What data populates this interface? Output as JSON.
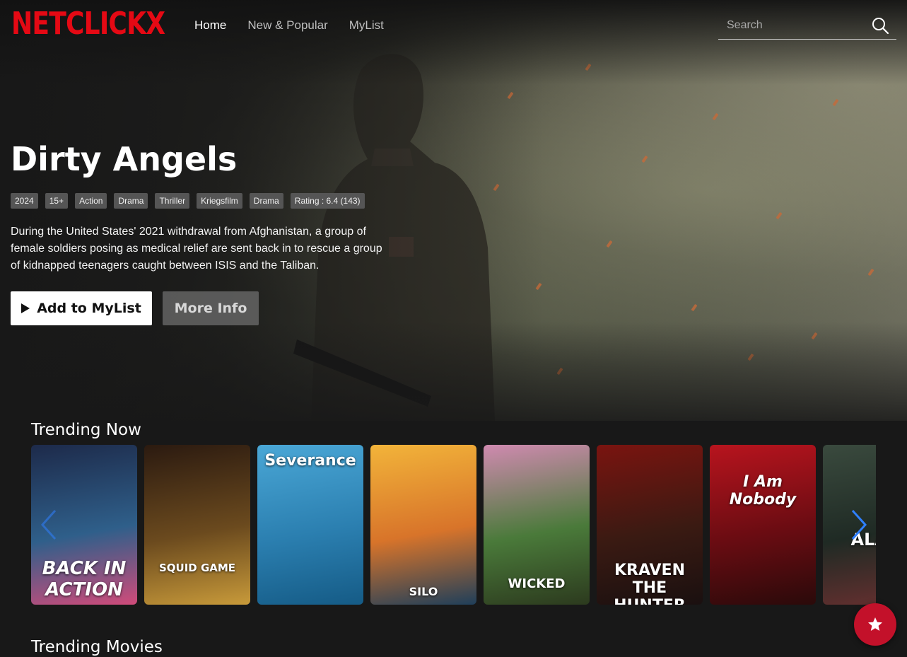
{
  "brand": {
    "logo": "NETCLICKX",
    "accent": "#e50914"
  },
  "nav": {
    "items": [
      {
        "label": "Home",
        "active": true
      },
      {
        "label": "New & Popular",
        "active": false
      },
      {
        "label": "MyList",
        "active": false
      }
    ]
  },
  "search": {
    "placeholder": "Search",
    "value": "",
    "icon": "search-icon"
  },
  "hero": {
    "title": "Dirty Angels",
    "tags": [
      "2024",
      "15+",
      "Action",
      "Drama",
      "Thriller",
      "Kriegsfilm",
      "Drama",
      "Rating : 6.4 (143)"
    ],
    "overview": "During the United States' 2021 withdrawal from Afghanistan, a group of female soldiers posing as medical relief are sent back in to rescue a group of kidnapped teenagers caught between ISIS and the Taliban.",
    "primary_button": "Add to MyList",
    "secondary_button": "More Info"
  },
  "rows": {
    "trending_now": {
      "title": "Trending Now",
      "cards": [
        {
          "poster_text": "BACK IN ACTION",
          "colors": [
            "#1d2a4a",
            "#2f5f8a",
            "#d04b7a"
          ]
        },
        {
          "poster_text": "SQUID GAME",
          "colors": [
            "#2b1a10",
            "#6b4a1e",
            "#c89a3a"
          ]
        },
        {
          "poster_text": "Severance",
          "colors": [
            "#4aa7d6",
            "#2b7fb0",
            "#155b86"
          ]
        },
        {
          "poster_text": "SILO",
          "colors": [
            "#f2b43a",
            "#d8742a",
            "#1f3f5a"
          ]
        },
        {
          "poster_text": "WICKED",
          "colors": [
            "#d08ab0",
            "#4a7a3a",
            "#2c3a1e"
          ]
        },
        {
          "poster_text": "KRAVEN THE HUNTER",
          "colors": [
            "#7a1410",
            "#3a1a12",
            "#1a1010"
          ]
        },
        {
          "poster_text": "I Am Nobody",
          "colors": [
            "#b8141e",
            "#6a0c12",
            "#2a0a0a"
          ]
        },
        {
          "poster_text": "ALAR",
          "colors": [
            "#3a4a3e",
            "#1f2a24",
            "#6a3030"
          ]
        }
      ]
    },
    "trending_movies": {
      "title": "Trending Movies"
    }
  },
  "fab": {
    "icon": "star-icon",
    "color": "#c3112a"
  }
}
